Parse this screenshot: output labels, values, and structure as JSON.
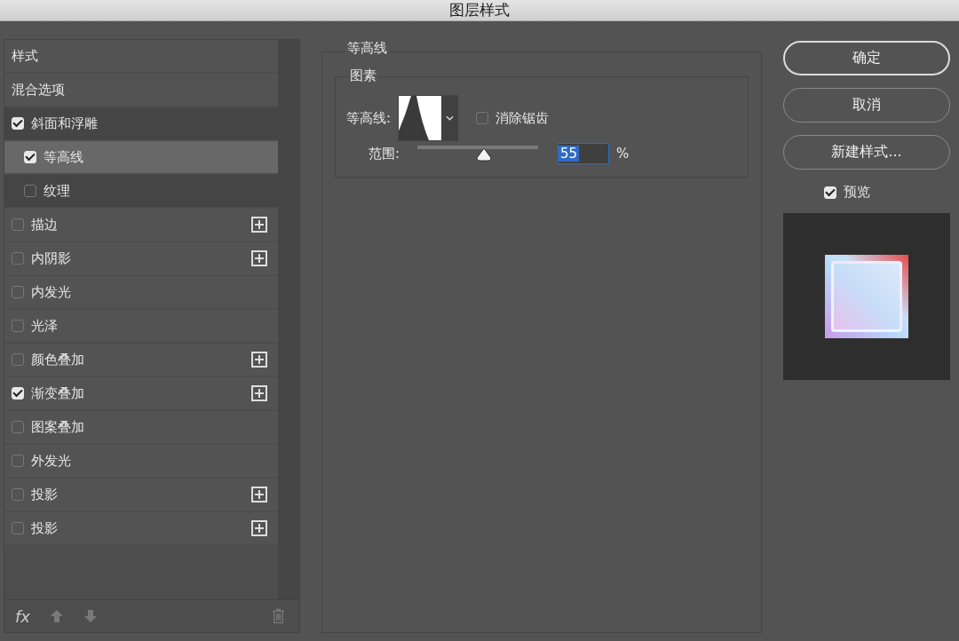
{
  "window": {
    "title": "图层样式"
  },
  "styles_list": {
    "items": [
      {
        "label": "样式",
        "kind": "header"
      },
      {
        "label": "混合选项",
        "kind": "option"
      },
      {
        "label": "斜面和浮雕",
        "kind": "effect",
        "checked": true,
        "selected": false,
        "add_button": false,
        "children": [
          {
            "label": "等高线",
            "checked": true,
            "selected": true,
            "add_button": false
          },
          {
            "label": "纹理",
            "checked": false,
            "selected": false,
            "add_button": false
          }
        ]
      },
      {
        "label": "描边",
        "kind": "effect",
        "checked": false,
        "selected": false,
        "add_button": true
      },
      {
        "label": "内阴影",
        "kind": "effect",
        "checked": false,
        "selected": false,
        "add_button": true
      },
      {
        "label": "内发光",
        "kind": "effect",
        "checked": false,
        "selected": false,
        "add_button": false
      },
      {
        "label": "光泽",
        "kind": "effect",
        "checked": false,
        "selected": false,
        "add_button": false
      },
      {
        "label": "颜色叠加",
        "kind": "effect",
        "checked": false,
        "selected": false,
        "add_button": true
      },
      {
        "label": "渐变叠加",
        "kind": "effect",
        "checked": true,
        "selected": false,
        "add_button": true
      },
      {
        "label": "图案叠加",
        "kind": "effect",
        "checked": false,
        "selected": false,
        "add_button": false
      },
      {
        "label": "外发光",
        "kind": "effect",
        "checked": false,
        "selected": false,
        "add_button": false
      },
      {
        "label": "投影",
        "kind": "effect",
        "checked": false,
        "selected": false,
        "add_button": true
      },
      {
        "label": "投影",
        "kind": "effect",
        "checked": false,
        "selected": false,
        "add_button": true
      }
    ],
    "footer": {
      "fx_label": "fx"
    }
  },
  "contour_panel": {
    "title": "等高线",
    "group": {
      "title": "图素",
      "contour_label": "等高线:",
      "anti_alias": {
        "label": "消除锯齿",
        "checked": false
      },
      "range": {
        "label": "范围:",
        "level": 0.55,
        "value": "55",
        "unit": "%"
      }
    }
  },
  "buttons": [
    "确定",
    "取消",
    "新建样式..."
  ],
  "preview": {
    "label": "预览",
    "checked": true
  }
}
